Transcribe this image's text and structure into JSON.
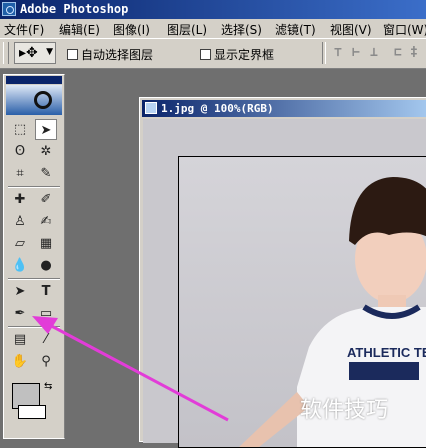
{
  "app": {
    "title": "Adobe Photoshop"
  },
  "menu": {
    "items": [
      "文件(F)",
      "编辑(E)",
      "图像(I)",
      "图层(L)",
      "选择(S)",
      "滤镜(T)",
      "视图(V)",
      "窗口(W)"
    ]
  },
  "options": {
    "auto_select_label": "自动选择图层",
    "show_bounds_label": "显示定界框",
    "auto_select_checked": false,
    "show_bounds_checked": false
  },
  "document": {
    "title": "1.jpg @ 100%(RGB)"
  },
  "photo": {
    "shirt_text": "ATHLETIC TEE"
  },
  "watermark": "软件技巧",
  "colors": {
    "titlebar": "#0a246a",
    "accent_arrow": "#e23cd8",
    "panel": "#d4d0c8",
    "workspace": "#6f6f6f"
  },
  "toolbox": {
    "highlighted_tool": "pen-tool"
  }
}
